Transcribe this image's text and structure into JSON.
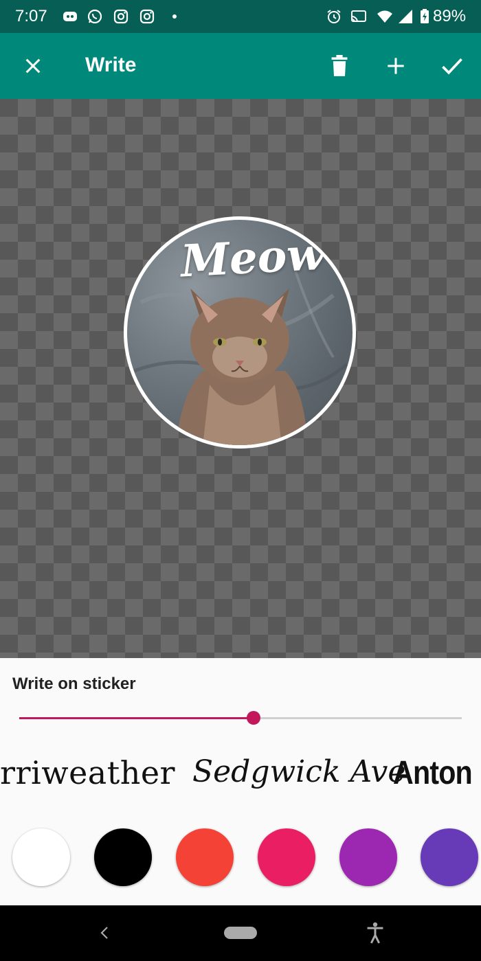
{
  "status_bar": {
    "time": "7:07",
    "battery": "89%",
    "icons": [
      "discord-icon",
      "whatsapp-icon",
      "instagram-icon",
      "instagram-icon",
      "dot-icon",
      "alarm-icon",
      "cast-icon",
      "wifi-icon",
      "signal-icon",
      "battery-charging-icon"
    ]
  },
  "toolbar": {
    "title": "Write",
    "close_icon": "close-icon",
    "delete_icon": "trash-icon",
    "add_icon": "plus-icon",
    "done_icon": "check-icon"
  },
  "sticker": {
    "text": "Meow"
  },
  "panel": {
    "heading": "Write on sticker",
    "slider_value": 0.53,
    "fonts": [
      "rriweather",
      "Sedgwick Ave",
      "Anton"
    ],
    "colors": [
      "#ffffff",
      "#000000",
      "#f44336",
      "#e91e63",
      "#9c27b0",
      "#673ab7"
    ],
    "accent": "#c2185b"
  },
  "colors": {
    "status_bar": "#075e54",
    "toolbar": "#00897b"
  }
}
